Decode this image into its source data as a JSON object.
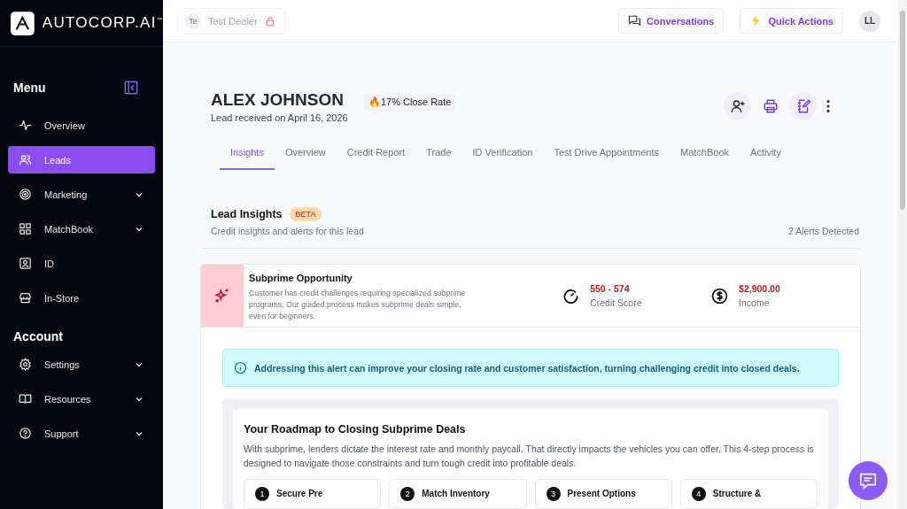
{
  "brand": {
    "name": "AUTOCORP.AI",
    "trademark": "™"
  },
  "sidebar": {
    "menu_title": "Menu",
    "menu_items": [
      {
        "label": "Overview",
        "selected": false,
        "expandable": false
      },
      {
        "label": "Leads",
        "selected": true,
        "expandable": false
      },
      {
        "label": "Marketing",
        "selected": false,
        "expandable": true
      },
      {
        "label": "MatchBook",
        "selected": false,
        "expandable": true
      },
      {
        "label": "ID",
        "selected": false,
        "expandable": false
      },
      {
        "label": "In-Store",
        "selected": false,
        "expandable": false
      }
    ],
    "account_title": "Account",
    "account_items": [
      {
        "label": "Settings",
        "selected": false,
        "expandable": true
      },
      {
        "label": "Resources",
        "selected": false,
        "expandable": true
      },
      {
        "label": "Support",
        "selected": false,
        "expandable": true
      }
    ]
  },
  "topbar": {
    "dealer": {
      "initials": "Te",
      "name": "Test Dealer",
      "locked": true
    },
    "buttons": [
      {
        "label": "Conversations",
        "kind": "chat"
      },
      {
        "label": "Quick Actions",
        "kind": "bolt"
      }
    ],
    "avatar": "LL"
  },
  "lead": {
    "name": "ALEX JOHNSON",
    "received": "Lead received on April 16, 2026",
    "close_rate": "🔥17% Close Rate"
  },
  "tabs": [
    {
      "label": "Insights",
      "selected": true
    },
    {
      "label": "Overview",
      "selected": false
    },
    {
      "label": "Credit Report",
      "selected": false
    },
    {
      "label": "Trade",
      "selected": false
    },
    {
      "label": "ID Verification",
      "selected": false
    },
    {
      "label": "Test Drive Appointments",
      "selected": false
    },
    {
      "label": "MatchBook",
      "selected": false
    },
    {
      "label": "Activity",
      "selected": false
    }
  ],
  "insights": {
    "title": "Lead Insights",
    "badge": "BETA",
    "subtitle": "Credit insights and alerts for this lead",
    "alerts_count": "2 Alerts Detected",
    "alert": {
      "title": "Subprime Opportunity",
      "description": "Customer has credit challenges requiring specialized subprime programs. Our guided process makes subprime deals simple, even for beginners.",
      "stats": [
        {
          "value": "550 - 574",
          "label": "Credit Score",
          "kind": "gauge"
        },
        {
          "value": "$2,900.00",
          "label": "Income",
          "kind": "dollar"
        }
      ]
    },
    "notice": "Addressing this alert can improve your closing rate and customer satisfaction, turning challenging credit into closed deals.",
    "roadmap": {
      "title": "Your Roadmap to Closing Subprime Deals",
      "text": "With subprime, lenders dictate the interest rate and monthly paycall. That directly impacts the vehicles you can offer. This 4-step process is designed to navigate those constraints and turn tough credit into profitable deals.",
      "steps": [
        {
          "number": "1",
          "title": "Secure Pre"
        },
        {
          "number": "2",
          "title": "Match Inventory"
        },
        {
          "number": "3",
          "title": "Present Options"
        },
        {
          "number": "4",
          "title": "Structure &"
        }
      ]
    }
  }
}
